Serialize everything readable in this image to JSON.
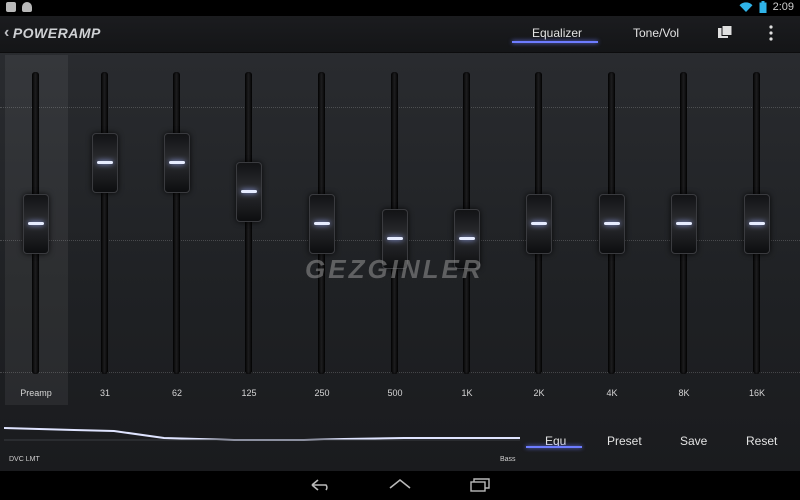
{
  "status_bar": {
    "time": "2:09",
    "left_icons": [
      "camera-icon",
      "android-icon"
    ],
    "right_icons": [
      "wifi-icon",
      "battery-icon"
    ]
  },
  "action_bar": {
    "logo_text": "POWERAMP",
    "tabs": [
      {
        "label": "Equalizer",
        "selected": true
      },
      {
        "label": "Tone/Vol",
        "selected": false
      }
    ],
    "icons": [
      "presets-folder-icon",
      "overflow-menu-icon"
    ]
  },
  "equalizer": {
    "bands": [
      {
        "label": "Preamp",
        "level": 0.5
      },
      {
        "label": "31",
        "level": 0.75
      },
      {
        "label": "62",
        "level": 0.75
      },
      {
        "label": "125",
        "level": 0.63
      },
      {
        "label": "250",
        "level": 0.5
      },
      {
        "label": "500",
        "level": 0.44
      },
      {
        "label": "1K",
        "level": 0.44
      },
      {
        "label": "2K",
        "level": 0.5
      },
      {
        "label": "4K",
        "level": 0.5
      },
      {
        "label": "8K",
        "level": 0.5
      },
      {
        "label": "16K",
        "level": 0.5
      }
    ],
    "watermark": "GEZGINLER",
    "accent_color": "#6d7cff"
  },
  "bottom": {
    "dvc_label": "DVC LMT",
    "bass_label": "Bass",
    "buttons": [
      {
        "label": "Equ",
        "selected": true
      },
      {
        "label": "Preset",
        "selected": false
      },
      {
        "label": "Save",
        "selected": false
      },
      {
        "label": "Reset",
        "selected": false
      }
    ]
  },
  "nav_bar": {
    "icons": [
      "back-icon",
      "home-icon",
      "recent-apps-icon"
    ]
  }
}
